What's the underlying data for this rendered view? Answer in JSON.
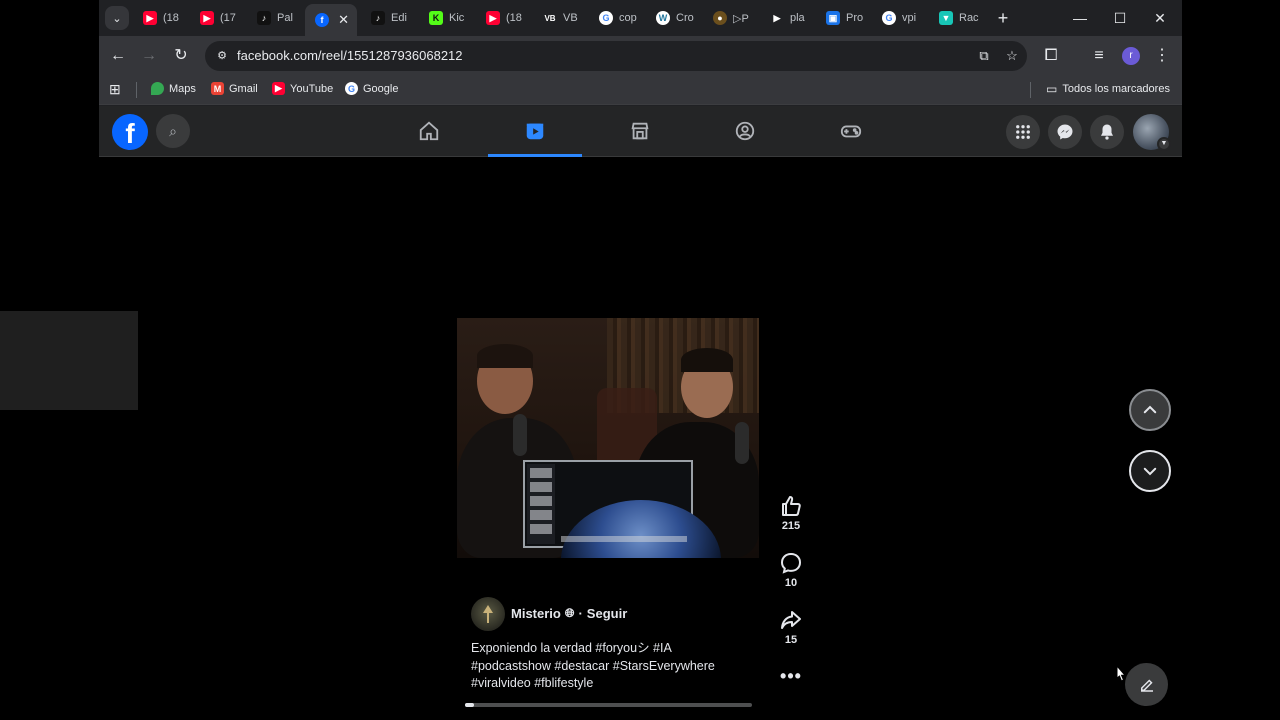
{
  "browser": {
    "tab_search_glyph": "⌄",
    "tabs": [
      {
        "label": "(18",
        "icon": "youtube-icon",
        "color": "#ff0033"
      },
      {
        "label": "(17",
        "icon": "youtube-icon",
        "color": "#ff0033"
      },
      {
        "label": "Pal",
        "icon": "tiktok-icon",
        "color": "#111111"
      },
      {
        "label": "",
        "icon": "facebook-icon",
        "color": "#0866ff"
      },
      {
        "label": "Edi",
        "icon": "tiktok-icon",
        "color": "#111111"
      },
      {
        "label": "Kic",
        "icon": "kick-icon",
        "color": "#53fc18"
      },
      {
        "label": "(18",
        "icon": "youtube-icon",
        "color": "#ff0033"
      },
      {
        "label": "VB",
        "icon": "vb-icon",
        "color": "#202124"
      },
      {
        "label": "cop",
        "icon": "google-icon",
        "color": "#ffffff"
      },
      {
        "label": "Cro",
        "icon": "wordpress-icon",
        "color": "#ffffff"
      },
      {
        "label": "▷P",
        "icon": "duck-icon",
        "color": "#6b4f1d"
      },
      {
        "label": "pla",
        "icon": "play-icon",
        "color": "#202124"
      },
      {
        "label": "Pro",
        "icon": "proton-icon",
        "color": "#1a73e8"
      },
      {
        "label": "vpi",
        "icon": "google-icon",
        "color": "#ffffff"
      },
      {
        "label": "Rac",
        "icon": "v-shield-icon",
        "color": "#18c6b7"
      }
    ],
    "close_glyph": "✕",
    "new_tab_glyph": "+",
    "window_controls": {
      "minimize": "—",
      "maximize": "☐",
      "close": "✕"
    },
    "address_bar": {
      "url": "facebook.com/reel/1551287936068212"
    },
    "profile_initial": "r",
    "bookmarks": [
      {
        "label": "Maps",
        "icon": "maps-icon",
        "color": "#34a853"
      },
      {
        "label": "Gmail",
        "icon": "gmail-icon",
        "color": "#ea4335"
      },
      {
        "label": "YouTube",
        "icon": "youtube-icon",
        "color": "#ff0033"
      },
      {
        "label": "Google",
        "icon": "google-icon",
        "color": "#ffffff"
      }
    ],
    "all_bookmarks_label": "Todos los marcadores"
  },
  "facebook": {
    "logo_glyph": "f",
    "brand_color": "#0866ff",
    "active_color": "#2d88ff"
  },
  "reel": {
    "author_name": "Misterio",
    "author_separator": "·",
    "follow_label": "Seguir",
    "caption_lines": [
      "Exponiendo la verdad  #foryouシ #IA",
      "#podcastshow #destacar #StarsEverywhere",
      "#viralvideo #fblifestyle"
    ],
    "likes": "215",
    "comments": "10",
    "shares": "15",
    "more_glyph": "•••",
    "progress_fraction": 0.03
  }
}
